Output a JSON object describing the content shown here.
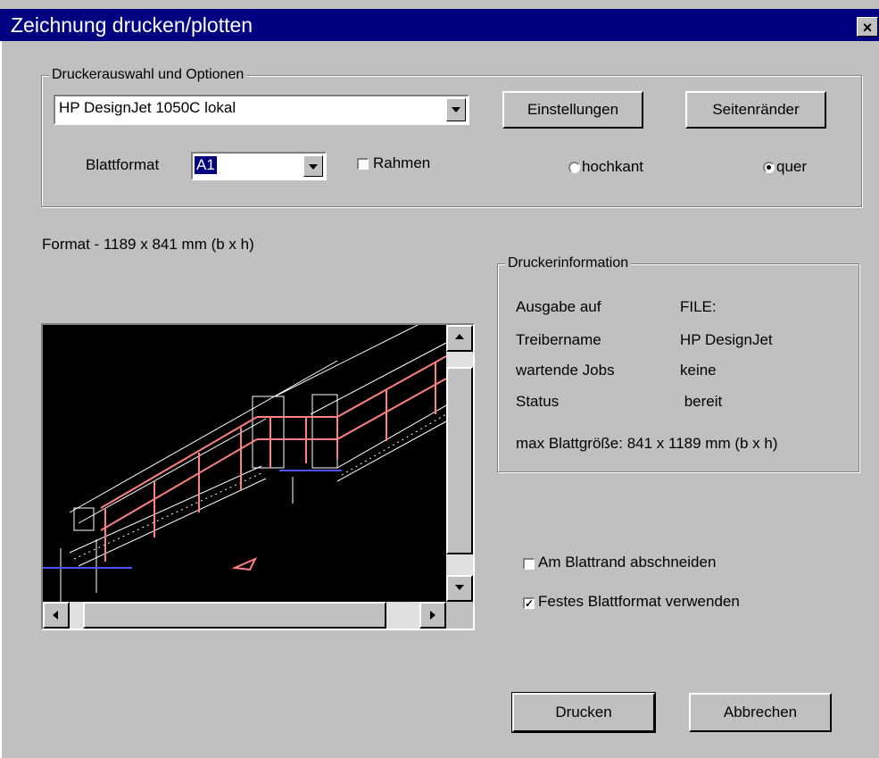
{
  "window": {
    "title": "Zeichnung drucken/plotten",
    "close_label": "×"
  },
  "printer_group": {
    "legend": "Druckerauswahl und Optionen",
    "printer_value": "HP DesignJet 1050C lokal",
    "settings_label": "Einstellungen",
    "margins_label": "Seitenränder",
    "paper_label": "Blattformat",
    "paper_value": "A1",
    "frame_label": "Rahmen",
    "frame_checked": false,
    "portrait_label": "hochkant",
    "landscape_label": "quer",
    "orientation": "quer"
  },
  "format_text": "Format  - 1189 x 841 mm (b x h)",
  "info_group": {
    "legend": "Druckerinformation",
    "rows": [
      {
        "key": "Ausgabe auf",
        "value": "FILE:"
      },
      {
        "key": "Treibername",
        "value": "HP DesignJet"
      },
      {
        "key": "wartende Jobs",
        "value": "keine"
      },
      {
        "key": "Status",
        "value": " bereit"
      }
    ],
    "max_size": "max Blattgröße: 841 x 1189 mm (b x h)"
  },
  "options": {
    "clip_label": "Am Blattrand abschneiden",
    "clip_checked": false,
    "fixed_label": "Festes Blattformat verwenden",
    "fixed_checked": true
  },
  "buttons": {
    "print_label": "Drucken",
    "cancel_label": "Abbrechen"
  },
  "colors": {
    "title_bar": "#000080",
    "face": "#c0c0c0",
    "drawing_red": "#ff8080",
    "drawing_blue": "#5050ff"
  }
}
